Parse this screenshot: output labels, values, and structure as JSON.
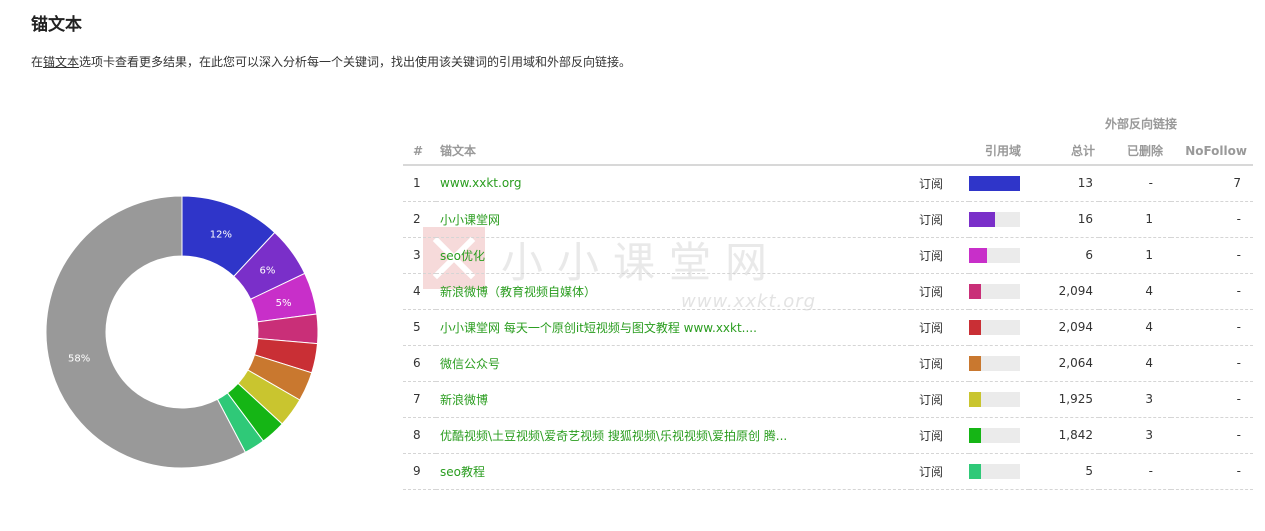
{
  "page": {
    "title": "锚文本",
    "desc_prefix": "在",
    "desc_link": "锚文本",
    "desc_suffix": "选项卡查看更多结果，在此您可以深入分析每一个关键词，找出使用该关键词的引用域和外部反向链接。"
  },
  "watermark": {
    "text": "小小课堂网",
    "url": "www.xxkt.org"
  },
  "table": {
    "group_header": "外部反向链接",
    "headers": {
      "num": "#",
      "anchor": "锚文本",
      "refdomains": "引用域",
      "total": "总计",
      "deleted": "已删除",
      "nofollow": "NoFollow"
    },
    "rows": [
      {
        "num": "1",
        "anchor": "www.xxkt.org",
        "subscribe": "订阅",
        "bar_color": "#2f35c9",
        "bar_fraction": 1.0,
        "total": "13",
        "deleted": "-",
        "nofollow": "7"
      },
      {
        "num": "2",
        "anchor": "小小课堂网",
        "subscribe": "订阅",
        "bar_color": "#7a2fc9",
        "bar_fraction": 0.5,
        "total": "16",
        "deleted": "1",
        "nofollow": "-"
      },
      {
        "num": "3",
        "anchor": "seo优化",
        "subscribe": "订阅",
        "bar_color": "#c82fc9",
        "bar_fraction": 0.35,
        "total": "6",
        "deleted": "1",
        "nofollow": "-"
      },
      {
        "num": "4",
        "anchor": "新浪微博（教育视频自媒体）",
        "subscribe": "订阅",
        "bar_color": "#c92f78",
        "bar_fraction": 0.24,
        "total": "2,094",
        "deleted": "4",
        "nofollow": "-"
      },
      {
        "num": "5",
        "anchor": "小小课堂网 每天一个原创it短视频与图文教程 www.xxkt....",
        "subscribe": "订阅",
        "bar_color": "#c92f35",
        "bar_fraction": 0.24,
        "total": "2,094",
        "deleted": "4",
        "nofollow": "-"
      },
      {
        "num": "6",
        "anchor": "微信公众号",
        "subscribe": "订阅",
        "bar_color": "#c9782f",
        "bar_fraction": 0.24,
        "total": "2,064",
        "deleted": "4",
        "nofollow": "-"
      },
      {
        "num": "7",
        "anchor": "新浪微博",
        "subscribe": "订阅",
        "bar_color": "#c9c52f",
        "bar_fraction": 0.24,
        "total": "1,925",
        "deleted": "3",
        "nofollow": "-"
      },
      {
        "num": "8",
        "anchor": "优酷视频\\土豆视频\\爱奇艺视频 搜狐视频\\乐视视频\\爱拍原创 腾...",
        "subscribe": "订阅",
        "bar_color": "#15b515",
        "bar_fraction": 0.24,
        "total": "1,842",
        "deleted": "3",
        "nofollow": "-"
      },
      {
        "num": "9",
        "anchor": "seo教程",
        "subscribe": "订阅",
        "bar_color": "#2fc978",
        "bar_fraction": 0.24,
        "total": "5",
        "deleted": "-",
        "nofollow": "-"
      }
    ]
  },
  "chart_data": {
    "type": "pie",
    "donut": true,
    "series": [
      {
        "value": 12,
        "label": "12%",
        "color": "#2f35c9"
      },
      {
        "value": 6,
        "label": "6%",
        "color": "#7a2fc9"
      },
      {
        "value": 5,
        "label": "5%",
        "color": "#c82fc9"
      },
      {
        "value": 3.5,
        "label": "",
        "color": "#c92f78"
      },
      {
        "value": 3.5,
        "label": "",
        "color": "#c92f35"
      },
      {
        "value": 3.5,
        "label": "",
        "color": "#c9782f"
      },
      {
        "value": 3.5,
        "label": "",
        "color": "#c9c52f"
      },
      {
        "value": 3,
        "label": "",
        "color": "#15b515"
      },
      {
        "value": 2.5,
        "label": "",
        "color": "#2fc978"
      },
      {
        "value": 58,
        "label": "58%",
        "color": "#999999"
      }
    ]
  }
}
